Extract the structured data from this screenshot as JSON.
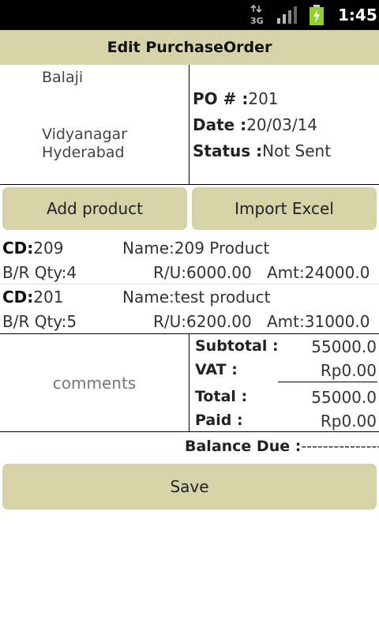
{
  "status_bar": {
    "network": "3G",
    "time": "1:45"
  },
  "title": "Edit PurchaseOrder",
  "vendor": {
    "name": "Balaji",
    "address_line1": "Vidyanagar",
    "address_line2": "Hyderabad"
  },
  "po": {
    "number_label": "PO # :",
    "number": "201",
    "date_label": "Date :",
    "date": "20/03/14",
    "status_label": "Status :",
    "status": "Not Sent"
  },
  "buttons": {
    "add_product": "Add product",
    "import_excel": "Import Excel",
    "save": "Save"
  },
  "items": [
    {
      "cd_label": "CD:",
      "cd": "209",
      "name_label": "Name:",
      "name": "209 Product",
      "qty_label": "B/R Qty:",
      "qty": "4",
      "ru_label": "R/U:",
      "ru": "6000.00",
      "amt_label": "Amt:",
      "amt": "24000.0"
    },
    {
      "cd_label": "CD:",
      "cd": "201",
      "name_label": "Name:",
      "name": "test product",
      "qty_label": "B/R Qty:",
      "qty": "5",
      "ru_label": "R/U:",
      "ru": "6200.00",
      "amt_label": "Amt:",
      "amt": "31000.0"
    }
  ],
  "comments_placeholder": "comments",
  "totals": {
    "subtotal_label": "Subtotal :",
    "subtotal": "55000.0",
    "vat_label": "VAT :",
    "vat": "Rp0.00",
    "total_label": "Total :",
    "total": "55000.0",
    "paid_label": "Paid :",
    "paid": "Rp0.00"
  },
  "balance": {
    "label": "Balance Due :",
    "value": "----------------"
  },
  "colors": {
    "accent": "#d6d3a9",
    "status_bar": "#000000",
    "battery": "#8fd12a"
  },
  "icons": [
    "3g-icon",
    "signal-icon",
    "battery-charging-icon"
  ]
}
